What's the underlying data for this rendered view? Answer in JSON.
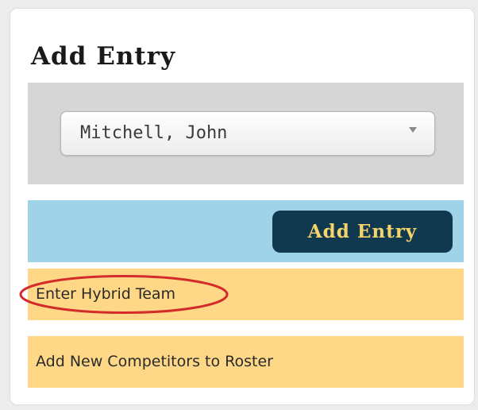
{
  "panel": {
    "title": "Add Entry"
  },
  "competitor_select": {
    "selected": "Mitchell, John"
  },
  "actions": {
    "add_entry_label": "Add Entry"
  },
  "options": {
    "hybrid_team_label": "Enter Hybrid Team",
    "add_competitors_label": "Add New Competitors to Roster"
  },
  "colors": {
    "select_band": "#d6d6d6",
    "action_band": "#9fd3ea",
    "button_bg": "#10394f",
    "button_text": "#f4d46a",
    "option_bg": "#ffd887",
    "highlight": "#d42a2a"
  },
  "icons": {
    "select_arrow": "chevron-down-icon"
  }
}
